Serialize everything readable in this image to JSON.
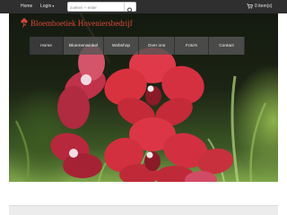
{
  "topbar": {
    "home_label": "Home",
    "login_label": "Login",
    "search_placeholder": "zoeken + enter",
    "cart_label": "0 item(s)"
  },
  "brand": {
    "title": "Bloemboetiek Hoveniersbedrijf"
  },
  "nav": {
    "items": [
      {
        "label": "Home"
      },
      {
        "label": "Bloemenwinkel"
      },
      {
        "label": "Webshop"
      },
      {
        "label": "Over ons"
      },
      {
        "label": "Foto's"
      },
      {
        "label": "Contact"
      }
    ]
  },
  "icons": {
    "logo": "flower-icon",
    "search": "search-icon",
    "cart": "cart-icon",
    "dropdown": "chevron-down-icon"
  },
  "colors": {
    "topbar": "#2f2f2f",
    "brand": "#d94a3a",
    "nav": "#555555"
  }
}
